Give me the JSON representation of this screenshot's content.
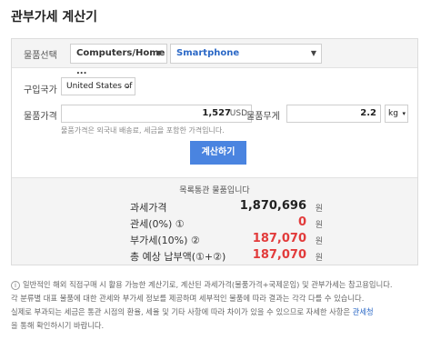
{
  "title": "관부가세 계산기",
  "category": {
    "label": "물품선택",
    "select1": "Computers/Home ...",
    "select2": "Smartphone"
  },
  "country": {
    "label": "구입국가",
    "value": "United States of"
  },
  "price": {
    "label": "물품가격",
    "value": "1,527",
    "unit": "USD"
  },
  "weight": {
    "label": "물품무게",
    "value": "2.2",
    "unit": "kg"
  },
  "note": "물품가격은 외국내 배송료, 세금을 포함한 가격입니다.",
  "calc_button": "계산하기",
  "result": {
    "heading": "목록통관 물품입니다",
    "rows": [
      {
        "key": "과세가격",
        "value": "1,870,696",
        "unit": "원"
      },
      {
        "key": "관세(0%) ①",
        "value": "0",
        "unit": "원"
      },
      {
        "key": "부가세(10%) ②",
        "value": "187,070",
        "unit": "원"
      },
      {
        "key": "총 예상 납부액(①+②)",
        "value": "187,070",
        "unit": "원"
      }
    ]
  },
  "info": {
    "line1": "일반적인 해외 직접구매 시 활용 가능한 계산기로, 계산된 과세가격(물품가격+국제운임) 및 관부가세는 참고용입니다.",
    "line2": "각 분류별 대표 물품에 대한 관세와 부가세 정보를 제공하며 세부적인 물품에 따라 결과는 각각 다를 수 있습니다.",
    "line3": "실제로 부과되는 세금은 통관 시점의 환율, 세율 및 기타 사항에 따라 차이가 있을 수 있으므로 자세한 사항은",
    "link": "관세청",
    "line4": "을 통해 확인하시기 바랍니다."
  },
  "colors": {
    "accent": "#4a84e0",
    "red": "#e23b3b",
    "link": "#2b68c6"
  }
}
